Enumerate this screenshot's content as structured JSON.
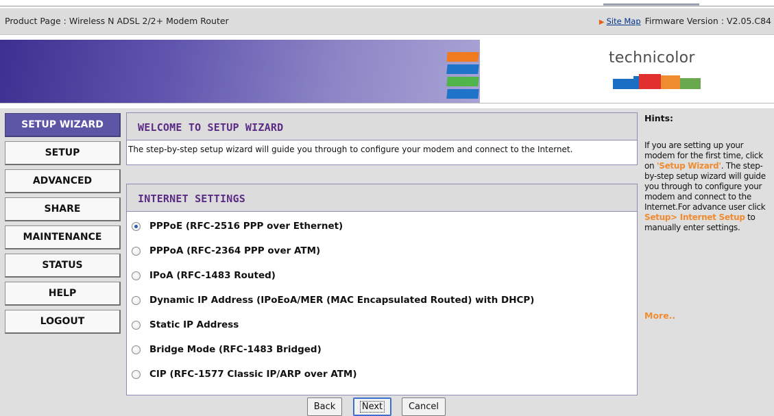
{
  "header": {
    "product_title": "Product Page : Wireless N ADSL 2/2+ Modem Router",
    "site_map_label": "Site Map",
    "firmware_label": "Firmware Version : V2.05.C84"
  },
  "brand": {
    "logo_text": "technicolor",
    "colors": {
      "banner_purple": "#5f55ae",
      "stripe_orange": "#f07a1e",
      "stripe_blue": "#1f73c8",
      "stripe_green": "#4fb54a",
      "logo_blue": "#1a6fc4",
      "logo_red": "#e0312f",
      "logo_orange": "#f08c30",
      "logo_green": "#6aa84f"
    }
  },
  "nav": {
    "items": [
      {
        "label": "SETUP WIZARD",
        "active": true
      },
      {
        "label": "SETUP",
        "active": false
      },
      {
        "label": "ADVANCED",
        "active": false
      },
      {
        "label": "SHARE",
        "active": false
      },
      {
        "label": "MAINTENANCE",
        "active": false
      },
      {
        "label": "STATUS",
        "active": false
      },
      {
        "label": "HELP",
        "active": false
      },
      {
        "label": "LOGOUT",
        "active": false
      }
    ]
  },
  "welcome": {
    "title": "WELCOME TO SETUP WIZARD",
    "text": "The step-by-step setup wizard will guide you through to configure your modem and connect to the Internet."
  },
  "internet": {
    "title": "INTERNET SETTINGS",
    "options": [
      {
        "label": "PPPoE (RFC-2516 PPP over Ethernet)",
        "selected": true
      },
      {
        "label": "PPPoA (RFC-2364 PPP over ATM)",
        "selected": false
      },
      {
        "label": "IPoA (RFC-1483 Routed)",
        "selected": false
      },
      {
        "label": "Dynamic IP Address (IPoEoA/MER (MAC Encapsulated Routed) with DHCP)",
        "selected": false
      },
      {
        "label": "Static IP Address",
        "selected": false
      },
      {
        "label": "Bridge Mode (RFC-1483 Bridged)",
        "selected": false
      },
      {
        "label": "CIP (RFC-1577 Classic IP/ARP over ATM)",
        "selected": false
      }
    ]
  },
  "buttons": {
    "back": "Back",
    "next": "Next",
    "cancel": "Cancel"
  },
  "hints": {
    "title": "Hints:",
    "text_1": "If you are setting up your modem for the first time, click on ",
    "link_1": "'Setup Wizard'",
    "text_2": ". The step-by-step setup wizard will guide you through to configure your modem and connect to the Internet.For advance user click ",
    "link_2": "Setup> Internet Setup",
    "text_3": " to manually enter settings.",
    "more": "More.."
  }
}
